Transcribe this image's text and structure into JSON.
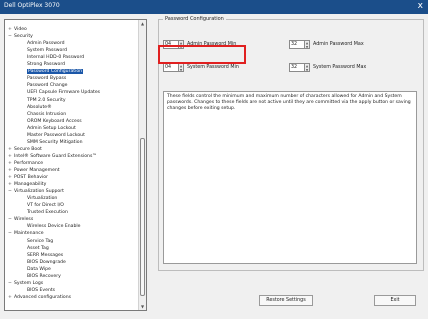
{
  "window": {
    "title": "Dell OptiPlex 3070",
    "close_glyph": "x"
  },
  "tree": {
    "items": [
      {
        "label": "Video",
        "exp": "+"
      },
      {
        "label": "Security",
        "exp": "−"
      },
      {
        "label": "Admin Password",
        "exp": ""
      },
      {
        "label": "System Password",
        "exp": ""
      },
      {
        "label": "Internal HDD-0 Password",
        "exp": ""
      },
      {
        "label": "Strong Password",
        "exp": ""
      },
      {
        "label": "Password Configuration",
        "exp": ""
      },
      {
        "label": "Password Bypass",
        "exp": ""
      },
      {
        "label": "Password Change",
        "exp": ""
      },
      {
        "label": "UEFI Capsule Firmware Updates",
        "exp": ""
      },
      {
        "label": "TPM 2.0 Security",
        "exp": ""
      },
      {
        "label": "Absolute®",
        "exp": ""
      },
      {
        "label": "Chassis Intrusion",
        "exp": ""
      },
      {
        "label": "OROM Keyboard Access",
        "exp": ""
      },
      {
        "label": "Admin Setup Lockout",
        "exp": ""
      },
      {
        "label": "Master Password Lockout",
        "exp": ""
      },
      {
        "label": "SMM Security Mitigation",
        "exp": ""
      },
      {
        "label": "Secure Boot",
        "exp": "+"
      },
      {
        "label": "Intel® Software Guard Extensions™",
        "exp": "+"
      },
      {
        "label": "Performance",
        "exp": "+"
      },
      {
        "label": "Power Management",
        "exp": "+"
      },
      {
        "label": "POST Behavior",
        "exp": "+"
      },
      {
        "label": "Manageability",
        "exp": "+"
      },
      {
        "label": "Virtualization Support",
        "exp": "−"
      },
      {
        "label": "Virtualization",
        "exp": ""
      },
      {
        "label": "VT for Direct I/O",
        "exp": ""
      },
      {
        "label": "Trusted Execution",
        "exp": ""
      },
      {
        "label": "Wireless",
        "exp": "−"
      },
      {
        "label": "Wireless Device Enable",
        "exp": ""
      },
      {
        "label": "Maintenance",
        "exp": "−"
      },
      {
        "label": "Service Tag",
        "exp": ""
      },
      {
        "label": "Asset Tag",
        "exp": ""
      },
      {
        "label": "SERR Messages",
        "exp": ""
      },
      {
        "label": "BIOS Downgrade",
        "exp": ""
      },
      {
        "label": "Data Wipe",
        "exp": ""
      },
      {
        "label": "BIOS Recovery",
        "exp": ""
      },
      {
        "label": "System Logs",
        "exp": "−"
      },
      {
        "label": "BIOS Events",
        "exp": ""
      },
      {
        "label": "Advanced configurations",
        "exp": "+"
      }
    ],
    "selected_label": "Password Configuration"
  },
  "group": {
    "title": "Password Configuration"
  },
  "fields": {
    "admin_min": {
      "value": "04",
      "label": "Admin Password Min"
    },
    "admin_max": {
      "value": "32",
      "label": "Admin Password Max"
    },
    "system_min": {
      "value": "04",
      "label": "System Password Min"
    },
    "system_max": {
      "value": "32",
      "label": "System Password Max"
    }
  },
  "description": "These fields control the minimum and maximum number of characters allowed for Admin and System passwords. Changes to these fields are not active until they are committed via the apply button or saving changes before exiting setup.",
  "buttons": {
    "restore": "Restore Settings",
    "exit": "Exit"
  },
  "colors": {
    "selection": "#1b57a8",
    "highlight": "#e02020",
    "titlebar": "#1b4e8a"
  }
}
